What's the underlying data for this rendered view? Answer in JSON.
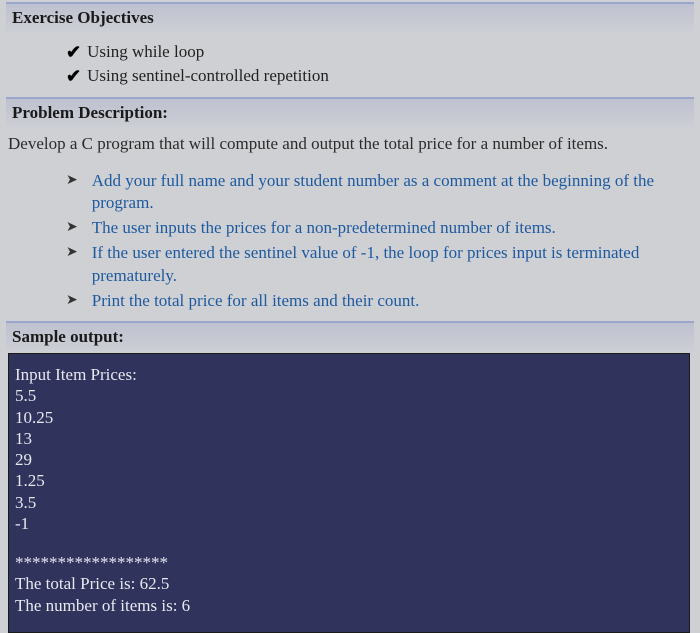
{
  "headers": {
    "exercise_objectives": "Exercise Objectives",
    "problem_description": "Problem Description:",
    "sample_output": "Sample output:"
  },
  "objectives": [
    "Using while loop",
    "Using sentinel-controlled repetition"
  ],
  "description": "Develop a C program that will compute and output the total price for a number of items.",
  "bullets": [
    "Add your full name and your student number as a comment at the beginning of the program.",
    "The user inputs the prices for a non-predetermined number of items.",
    "If the user entered the sentinel value of -1, the loop for prices input is terminated prematurely.",
    "Print the total price for all items and their count."
  ],
  "console": {
    "prompt": "Input Item Prices:",
    "inputs": [
      "5.5",
      "10.25",
      "13",
      "29",
      "1.25",
      "3.5",
      "-1"
    ],
    "divider": "******************",
    "total_line": "The total Price is: 62.5",
    "count_line": "The number of items is: 6"
  },
  "chart_data": {
    "type": "table",
    "title": "Sample console run — item prices with sentinel -1",
    "inputs": [
      5.5,
      10.25,
      13,
      29,
      1.25,
      3.5
    ],
    "sentinel": -1,
    "total_price": 62.5,
    "item_count": 6
  }
}
